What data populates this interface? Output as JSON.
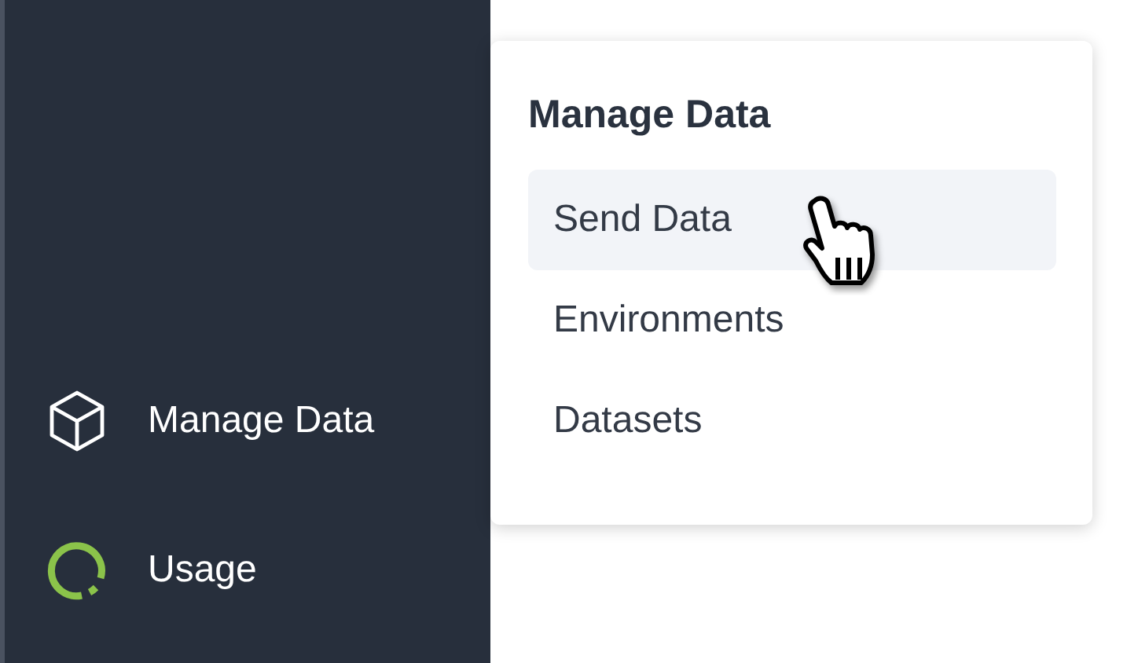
{
  "sidebar": {
    "items": [
      {
        "label": "Manage Data",
        "kind": "cube"
      },
      {
        "label": "Usage",
        "kind": "ring"
      }
    ]
  },
  "menu": {
    "title": "Manage Data",
    "items": [
      {
        "label": "Send Data",
        "selected": true
      },
      {
        "label": "Environments",
        "selected": false
      },
      {
        "label": "Datasets",
        "selected": false
      }
    ]
  }
}
